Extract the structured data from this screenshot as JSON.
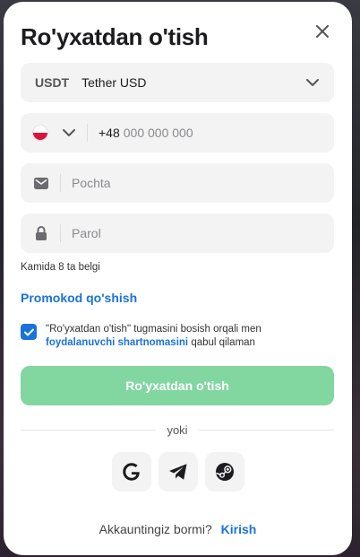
{
  "modal": {
    "title": "Ro'yxatdan o'tish"
  },
  "currency": {
    "code": "USDT",
    "name": "Tether USD"
  },
  "phone": {
    "country_code": "+48",
    "placeholder": "000 000 000"
  },
  "email": {
    "placeholder": "Pochta"
  },
  "password": {
    "placeholder": "Parol",
    "hint": "Kamida 8 ta belgi"
  },
  "promo": {
    "label": "Promokod qo'shish"
  },
  "agreement": {
    "text_before": "\"Ro'yxatdan o'tish\" tugmasini bosish orqali men",
    "link": "foydalanuvchi shartnomasini",
    "text_after": "qabul qilaman",
    "checked": true
  },
  "submit": {
    "label": "Ro'yxatdan o'tish",
    "color": "#82d6a0"
  },
  "divider": {
    "label": "yoki"
  },
  "socials": [
    {
      "icon": "google-icon"
    },
    {
      "icon": "telegram-icon"
    },
    {
      "icon": "steam-icon"
    }
  ],
  "footer": {
    "question": "Akkauntingiz bormi?",
    "login": "Kirish"
  },
  "colors": {
    "accent": "#1a73d9",
    "field_bg": "#f3f3f4"
  }
}
